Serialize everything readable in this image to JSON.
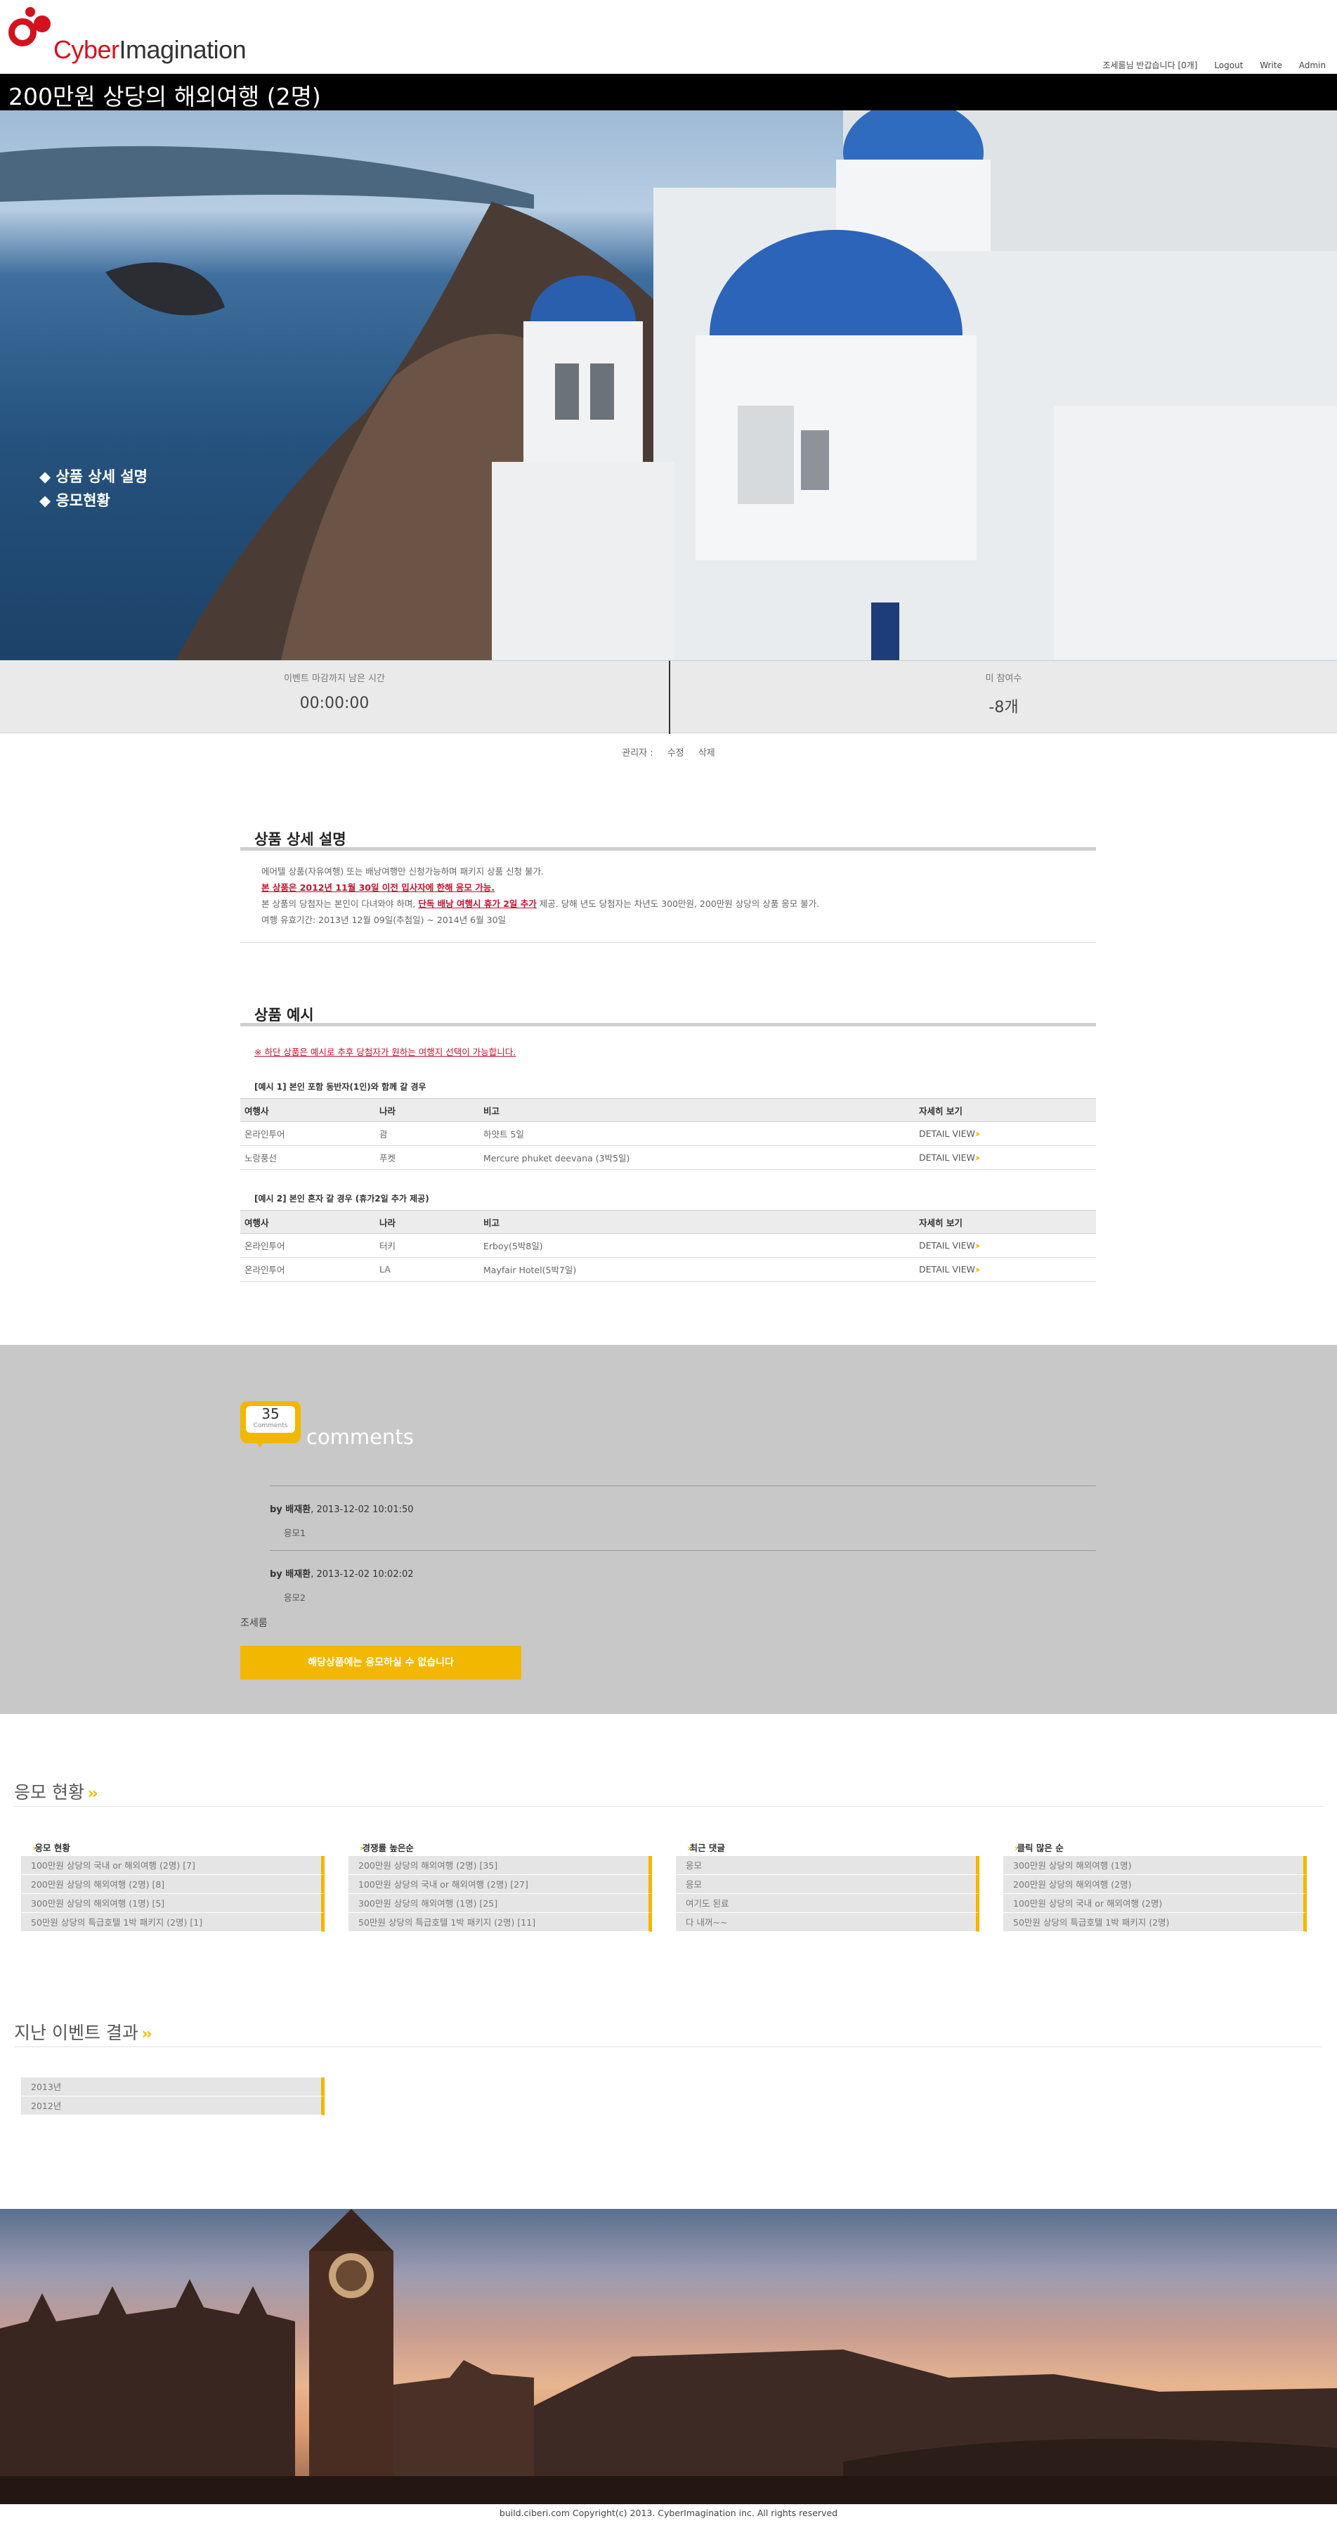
{
  "brand": {
    "logo_part1": "Cyber",
    "logo_part2": "Imagination"
  },
  "top_nav": {
    "greeting": "조세룸님 반갑습니다 [0개]",
    "logout": "Logout",
    "write": "Write",
    "admin": "Admin"
  },
  "page_title": "200만원 상당의 해외여행 (2명)",
  "hero_menu": [
    "◆ 상품 상세 설명",
    "◆ 응모현황"
  ],
  "stats": {
    "time_label": "이벤트 마감까지 남은 시간",
    "time_value": "00:00:00",
    "count_label": "미 참여수",
    "count_value": "-8개"
  },
  "admin_bar": {
    "label": "관리자 :",
    "edit": "수정",
    "delete": "삭제"
  },
  "detail": {
    "title": "상품 상세 설명",
    "line1": "에어텔 상품(자유여행) 또는 배낭여행만 신청가능하며 패키지 상품 신청 불가.",
    "line2": "본 상품은 2012년 11월 30일 이전 입사자에 한해 응모 가능.",
    "line3a": "본 상품의 당첨자는 본인이 다녀와야 하며, ",
    "line3b": "단독 배낭 여행시 휴가 2일 추가",
    "line3c": " 제공. 당해 년도 당첨자는 차년도 300만원, 200만원 상당의 상품 응모 불가.",
    "line4": "여행 유효기간: 2013년 12월 09일(추첨일) ~ 2014년 6월 30일"
  },
  "examples": {
    "title": "상품 예시",
    "notice": "※ 하단 상품은 예시로 추후 당첨자가 원하는 여행지 선택이 가능합니다.",
    "headers": [
      "여행사",
      "나라",
      "비고",
      "자세히 보기"
    ],
    "ex1_caption": "[예시 1] 본인 포함 동반자(1인)와 함께 갈 경우",
    "ex1_rows": [
      [
        "온라인투어",
        "괌",
        "하얏트 5일",
        "DETAIL VIEW"
      ],
      [
        "노랑풍선",
        "푸켓",
        "Mercure phuket deevana (3박5일)",
        "DETAIL VIEW"
      ]
    ],
    "ex2_caption": "[예시 2] 본인 혼자 갈 경우 (휴가2일 추가 제공)",
    "ex2_rows": [
      [
        "온라인투어",
        "터키",
        "Erboy(5박8일)",
        "DETAIL VIEW"
      ],
      [
        "온라인투어",
        "LA",
        "Mayfair Hotel(5박7일)",
        "DETAIL VIEW"
      ]
    ]
  },
  "comments": {
    "count": "35",
    "count_caption": "Comments",
    "title": "comments",
    "items": [
      {
        "by": "by 배재환",
        "date": ", 2013-12-02 10:01:50",
        "msg": "응모1"
      },
      {
        "by": "by 배재환",
        "date": ", 2013-12-02 10:02:02",
        "msg": "응모2"
      }
    ],
    "user": "조세룸",
    "button": "해당상품에는 응모하실 수 없습니다"
  },
  "status": {
    "title": "응모 현황",
    "columns": [
      {
        "heading": "응모 현황",
        "rows": [
          "100만원 상당의 국내 or 해외여행 (2명) [7]",
          "200만원 상당의 해외여행 (2명) [8]",
          "300만원 상당의 해외여행 (1명) [5]",
          "50만원 상당의 특급호텔 1박 패키지 (2명) [1]"
        ]
      },
      {
        "heading": "경쟁률 높은순",
        "rows": [
          "200만원 상당의 해외여행 (2명) [35]",
          "100만원 상당의 국내 or 해외여행 (2명) [27]",
          "300만원 상당의 해외여행 (1명) [25]",
          "50만원 상당의 특급호텔 1박 패키지 (2명) [11]"
        ]
      },
      {
        "heading": "최근 댓글",
        "rows": [
          "응모",
          "응모",
          "여기도 된료",
          "다 내꺼~~"
        ]
      },
      {
        "heading": "클릭 많은 순",
        "rows": [
          "300만원 상당의 해외여행 (1명)",
          "200만원 상당의 해외여행 (2명)",
          "100만원 상당의 국내 or 해외여행 (2명)",
          "50만원 상당의 특급호텔 1박 패키지 (2명)"
        ]
      }
    ]
  },
  "past": {
    "title": "지난 이벤트 결과",
    "years": [
      "2013년",
      "2012년"
    ]
  },
  "footer": {
    "copyright": "build.ciberi.com Copyright(c) 2013. CyberImagination inc. All rights reserved"
  },
  "colors": {
    "accent": "#f2b700",
    "brand_red": "#d3121e",
    "title_bar": "#000000"
  }
}
